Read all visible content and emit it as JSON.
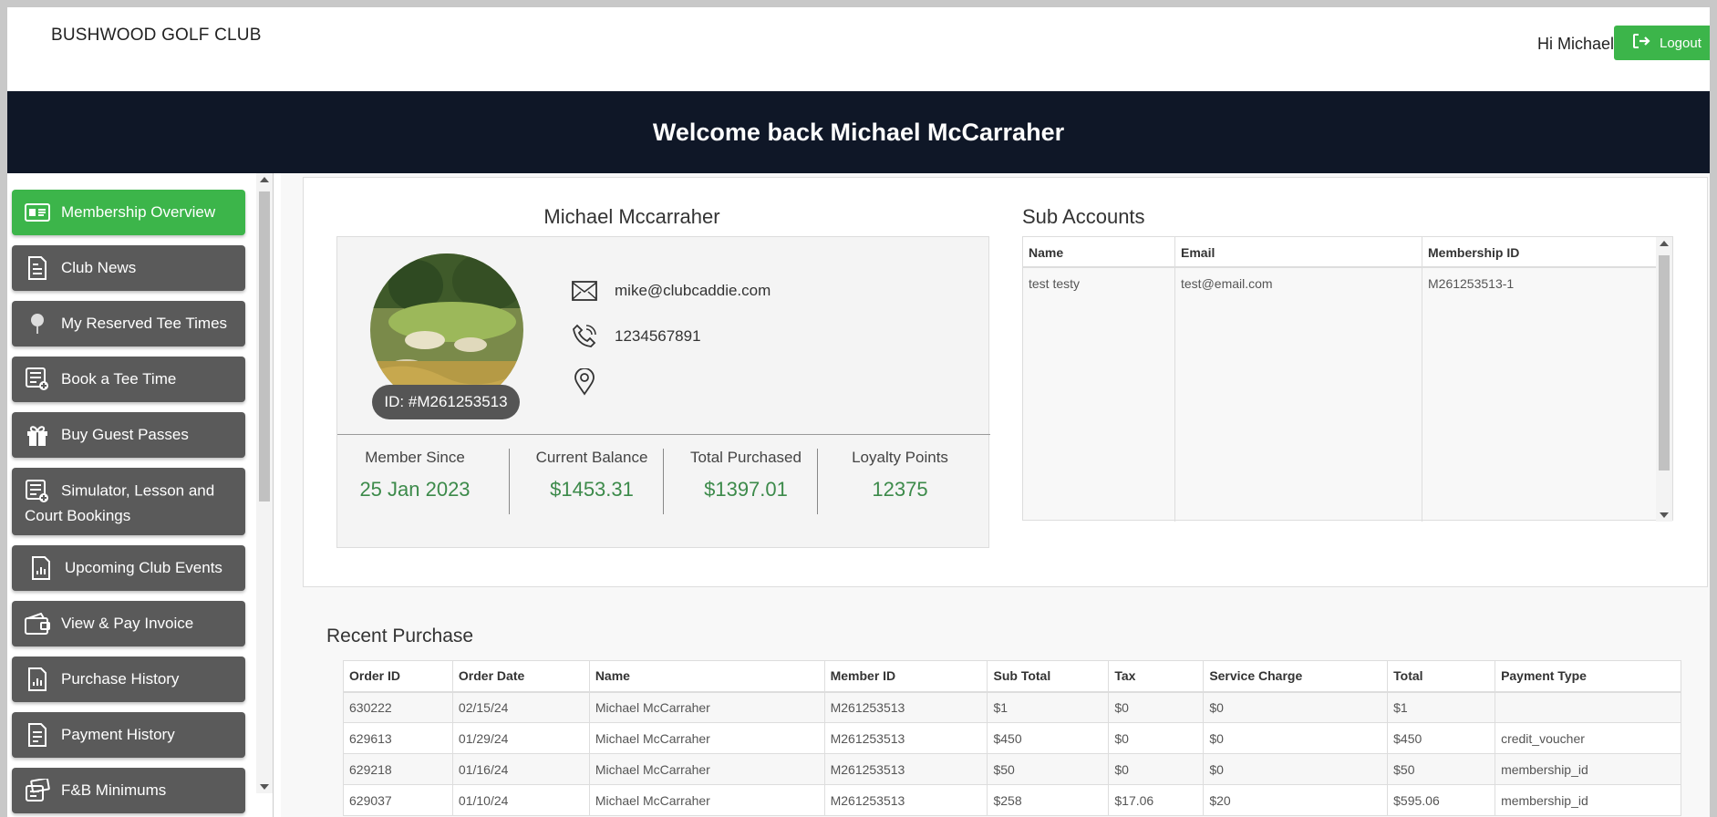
{
  "header": {
    "brand": "BUSHWOOD GOLF CLUB",
    "greeting": "Hi Michael",
    "logout_label": "Logout"
  },
  "banner": {
    "title": "Welcome back Michael McCarraher"
  },
  "sidebar": {
    "items": [
      {
        "label": "Membership Overview",
        "icon": "id-card-icon",
        "active": true
      },
      {
        "label": "Club News",
        "icon": "document-icon"
      },
      {
        "label": "My Reserved Tee Times",
        "icon": "golf-ball-icon"
      },
      {
        "label": "Book a Tee Time",
        "icon": "list-add-icon"
      },
      {
        "label": "Buy Guest Passes",
        "icon": "gift-icon"
      },
      {
        "label": "Simulator, Lesson and Court Bookings",
        "icon": "list-add-icon"
      },
      {
        "label": "Upcoming Club Events",
        "icon": "chart-document-icon"
      },
      {
        "label": "View & Pay Invoice",
        "icon": "wallet-icon"
      },
      {
        "label": "Purchase History",
        "icon": "chart-document-icon"
      },
      {
        "label": "Payment History",
        "icon": "receipt-icon"
      },
      {
        "label": "F&B Minimums",
        "icon": "cash-icon"
      }
    ]
  },
  "profile": {
    "name": "Michael Mccarraher",
    "id_label": "ID: #M261253513",
    "email": "mike@clubcaddie.com",
    "phone": "1234567891",
    "address": "",
    "stats": [
      {
        "label": "Member Since",
        "value": "25 Jan 2023"
      },
      {
        "label": "Current Balance",
        "value": "$1453.31"
      },
      {
        "label": "Total Purchased",
        "value": "$1397.01"
      },
      {
        "label": "Loyalty Points",
        "value": "12375"
      }
    ]
  },
  "sub_accounts": {
    "title": "Sub Accounts",
    "headers": [
      "Name",
      "Email",
      "Membership ID"
    ],
    "rows": [
      [
        "test testy",
        "test@email.com",
        "M261253513-1"
      ]
    ]
  },
  "recent_purchase": {
    "title": "Recent Purchase",
    "headers": [
      "Order ID",
      "Order Date",
      "Name",
      "Member ID",
      "Sub Total",
      "Tax",
      "Service Charge",
      "Total",
      "Payment Type"
    ],
    "rows": [
      [
        "630222",
        "02/15/24",
        "Michael McCarraher",
        "M261253513",
        "$1",
        "$0",
        "$0",
        "$1",
        ""
      ],
      [
        "629613",
        "01/29/24",
        "Michael McCarraher",
        "M261253513",
        "$450",
        "$0",
        "$0",
        "$450",
        "credit_voucher"
      ],
      [
        "629218",
        "01/16/24",
        "Michael McCarraher",
        "M261253513",
        "$50",
        "$0",
        "$0",
        "$50",
        "membership_id"
      ],
      [
        "629037",
        "01/10/24",
        "Michael McCarraher",
        "M261253513",
        "$258",
        "$17.06",
        "$20",
        "$595.06",
        "membership_id"
      ]
    ]
  },
  "colors": {
    "accent_green": "#3cb54a",
    "banner_navy": "#0f1727",
    "sidebar_gray": "#5a5a5a",
    "stat_green": "#3c8a4a"
  }
}
